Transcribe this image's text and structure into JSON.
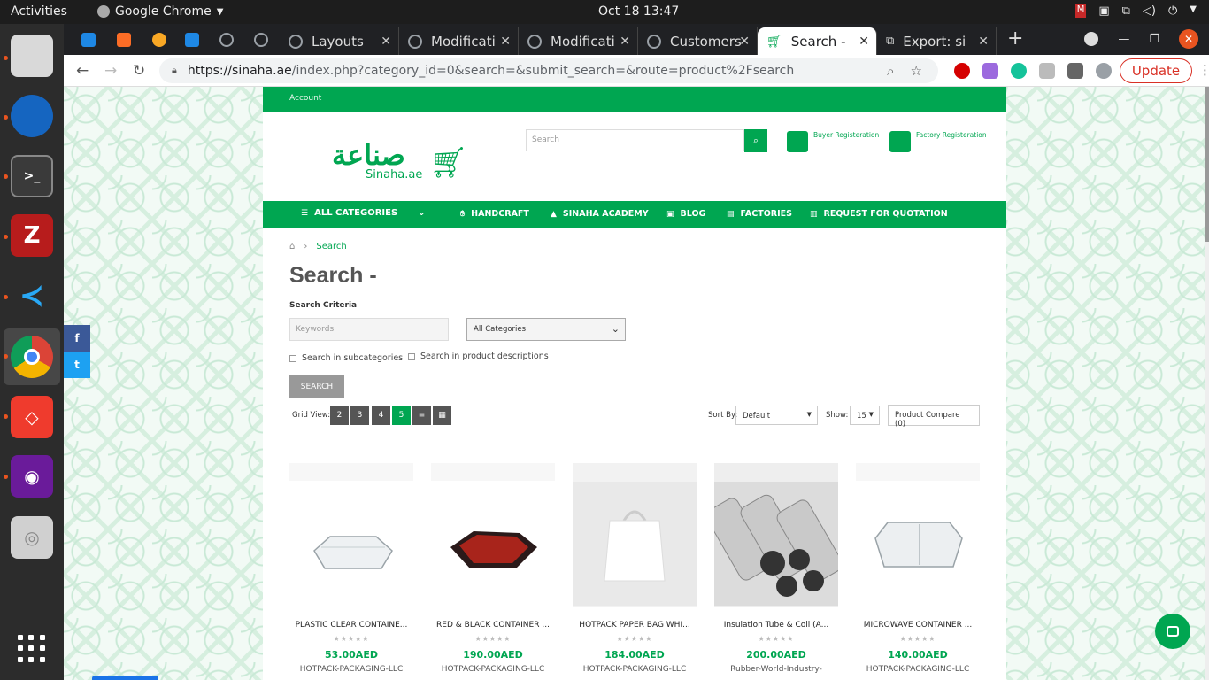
{
  "system": {
    "activities": "Activities",
    "app_name": "Google Chrome",
    "clock": "Oct 18  13:47"
  },
  "dock": {
    "apps": [
      "files",
      "thunderbird",
      "terminal",
      "filezilla",
      "vscode",
      "chrome",
      "anydesk",
      "video-editor",
      "disk"
    ]
  },
  "browser": {
    "tabs": [
      {
        "label": "Layouts"
      },
      {
        "label": "Modificati"
      },
      {
        "label": "Modificati"
      },
      {
        "label": "Customers"
      },
      {
        "label": "Search -"
      },
      {
        "label": "Export: si"
      }
    ],
    "url_host": "https://sinaha.ae",
    "url_path": "/index.php?category_id=0&search=&submit_search=&route=product%2Fsearch",
    "update_label": "Update"
  },
  "site": {
    "account_label": "Account",
    "logo_arabic": "صناعة",
    "logo_latin": "Sinaha.ae",
    "search_placeholder": "Search",
    "buyer_reg": "Buyer Registeration",
    "factory_reg": "Factory Registeration",
    "nav": {
      "all_categories": "ALL CATEGORIES",
      "handcraft": "HANDCRAFT",
      "academy": "SINAHA ACADEMY",
      "blog": "BLOG",
      "factories": "FACTORIES",
      "rfq": "REQUEST FOR QUOTATION"
    },
    "breadcrumb": "Search",
    "page_title": "Search -",
    "criteria_label": "Search Criteria",
    "keywords_placeholder": "Keywords",
    "category_selected": "All Categories",
    "chk_subcategories": "Search in subcategories",
    "chk_descriptions": "Search in product descriptions",
    "search_button": "SEARCH",
    "toolbar": {
      "grid_view_label": "Grid View:",
      "grid_options": [
        "2",
        "3",
        "4",
        "5"
      ],
      "sort_label": "Sort By:",
      "sort_value": "Default",
      "show_label": "Show:",
      "show_value": "15",
      "compare": "Product Compare (0)"
    },
    "products": [
      {
        "name": "PLASTIC CLEAR CONTAINE...",
        "stars": "★★★★★",
        "price": "53.00AED",
        "seller": "HOTPACK-PACKAGING-LLC"
      },
      {
        "name": "RED & BLACK CONTAINER ...",
        "stars": "★★★★★",
        "price": "190.00AED",
        "seller": "HOTPACK-PACKAGING-LLC"
      },
      {
        "name": "HOTPACK PAPER BAG WHI...",
        "stars": "★★★★★",
        "price": "184.00AED",
        "seller": "HOTPACK-PACKAGING-LLC"
      },
      {
        "name": "Insulation Tube & Coil (A...",
        "stars": "★★★★★",
        "price": "200.00AED",
        "seller": "Rubber-World-Industry-"
      },
      {
        "name": "MICROWAVE CONTAINER ...",
        "stars": "★★★★★",
        "price": "140.00AED",
        "seller": "HOTPACK-PACKAGING-LLC"
      }
    ]
  },
  "colors": {
    "brand_green": "#00a651",
    "ubuntu_orange": "#e95420"
  }
}
